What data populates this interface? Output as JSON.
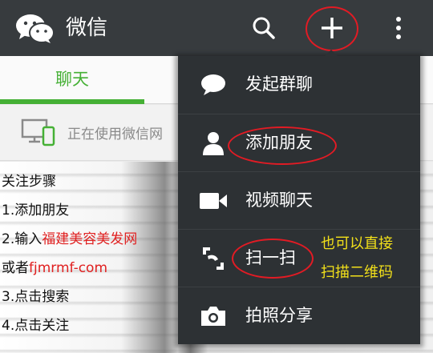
{
  "header": {
    "title": "微信",
    "icons": {
      "logo": "wechat-logo",
      "search": "search-icon",
      "add": "plus-icon",
      "more": "more-vertical-icon"
    }
  },
  "tabs": [
    {
      "label": "聊天",
      "active": true
    }
  ],
  "pc_banner": {
    "text": "正在使用微信网"
  },
  "steps": {
    "line1": "关注步骤",
    "line2": "1.添加朋友",
    "line3_prefix": "2.输入",
    "line3_red": "福建美容美发网",
    "line4_prefix": "或者",
    "line4_red": "fjmrmf-com",
    "line5": "3.点击搜索",
    "line6": "4.点击关注"
  },
  "menu": {
    "items": [
      {
        "label": "发起群聊",
        "icon": "chat-bubble-icon"
      },
      {
        "label": "添加朋友",
        "icon": "person-icon"
      },
      {
        "label": "视频聊天",
        "icon": "video-camera-icon"
      },
      {
        "label": "扫一扫",
        "icon": "scan-icon"
      },
      {
        "label": "拍照分享",
        "icon": "camera-icon"
      }
    ]
  },
  "annotation": {
    "line1": "也可以直接",
    "line2": "扫描二维码"
  },
  "colors": {
    "topbar": "#373b3e",
    "menu": "#2d3134",
    "accent": "#45b035",
    "highlight": "#e21b24",
    "note": "#f2e01a"
  }
}
